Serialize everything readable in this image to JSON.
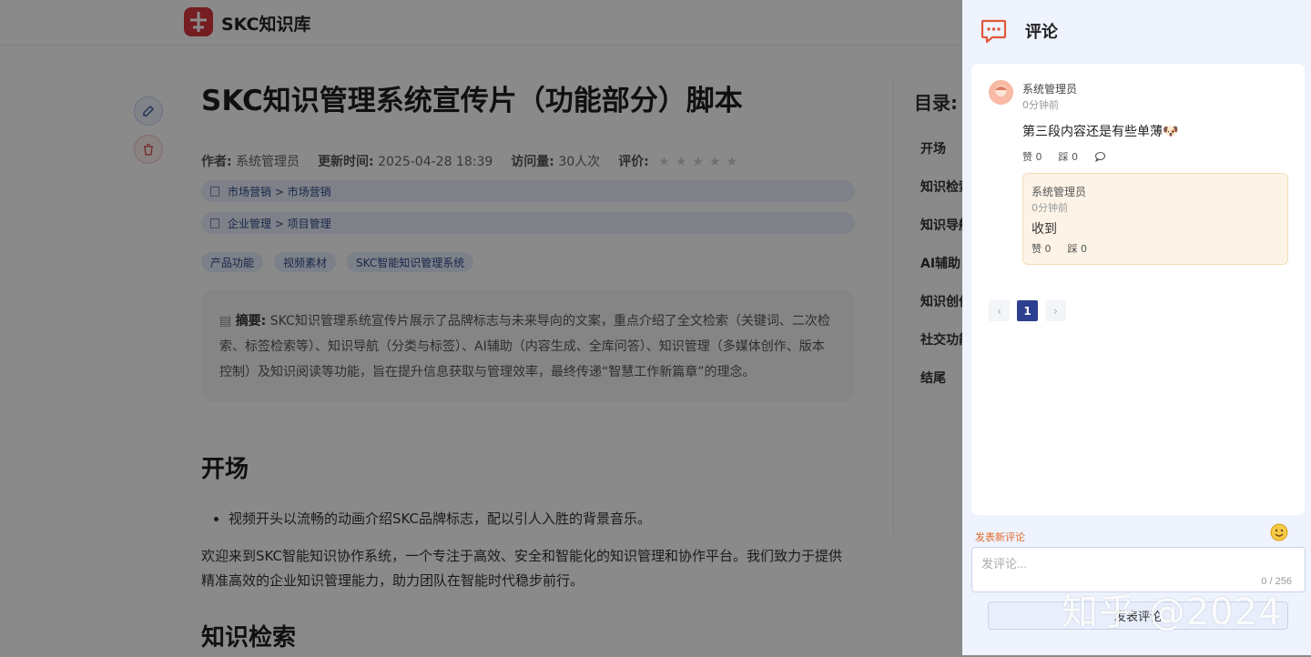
{
  "brand": {
    "name": "SKC知识库"
  },
  "article": {
    "title": "SKC知识管理系统宣传片（功能部分）脚本",
    "meta": {
      "author_label": "作者:",
      "author": "系统管理员",
      "updated_label": "更新时间:",
      "updated": "2025-04-28 18:39",
      "visits_label": "访问量:",
      "visits": "30人次",
      "rating_label": "评价:",
      "rating_stars": 0
    },
    "categories": [
      "市场营销 > 市场营销",
      "企业管理 > 项目管理"
    ],
    "tags": [
      "产品功能",
      "视频素材",
      "SKC智能知识管理系统"
    ],
    "summary_label": "摘要:",
    "summary": "SKC知识管理系统宣传片展示了品牌标志与未来导向的文案，重点介绍了全文检索（关键词、二次检索、标签检索等）、知识导航（分类与标签）、AI辅助（内容生成、全库问答）、知识管理（多媒体创作、版本控制）及知识阅读等功能，旨在提升信息获取与管理效率，最终传递“智慧工作新篇章”的理念。",
    "section1_heading": "开场",
    "section1_bullet": "视频开头以流畅的动画介绍SKC品牌标志，配以引人入胜的背景音乐。",
    "section1_para": "欢迎来到SKC智能知识协作系统，一个专注于高效、安全和智能化的知识管理和协作平台。我们致力于提供精准高效的企业知识管理能力，助力团队在智能时代稳步前行。",
    "section2_heading": "知识检索"
  },
  "toc": {
    "title": "目录:",
    "items": [
      "开场",
      "知识检索",
      "知识导航",
      "AI辅助",
      "知识创作",
      "社交功能",
      "结尾"
    ]
  },
  "comments": {
    "title": "评论",
    "items": [
      {
        "name": "系统管理员",
        "time": "0分钟前",
        "text": "第三段内容还是有些单薄🐶",
        "likes": "赞 0",
        "dislikes": "踩 0",
        "replies": [
          {
            "name": "系统管理员",
            "time": "0分钟前",
            "text": "收到",
            "likes": "赞 0",
            "dislikes": "踩 0"
          }
        ]
      }
    ],
    "pagination": {
      "prev": "‹",
      "current": "1",
      "next": "›"
    },
    "new_comment_label": "发表新评论",
    "input_placeholder": "发评论...",
    "counter": "0 / 256",
    "submit_label": "发表评论"
  },
  "watermark": "知乎 @2024",
  "colors": {
    "accent": "#2d3f8f",
    "brand_red": "#d9363e",
    "drawer_bg": "#eef3fd",
    "reply_bg": "#fdf4e7"
  }
}
